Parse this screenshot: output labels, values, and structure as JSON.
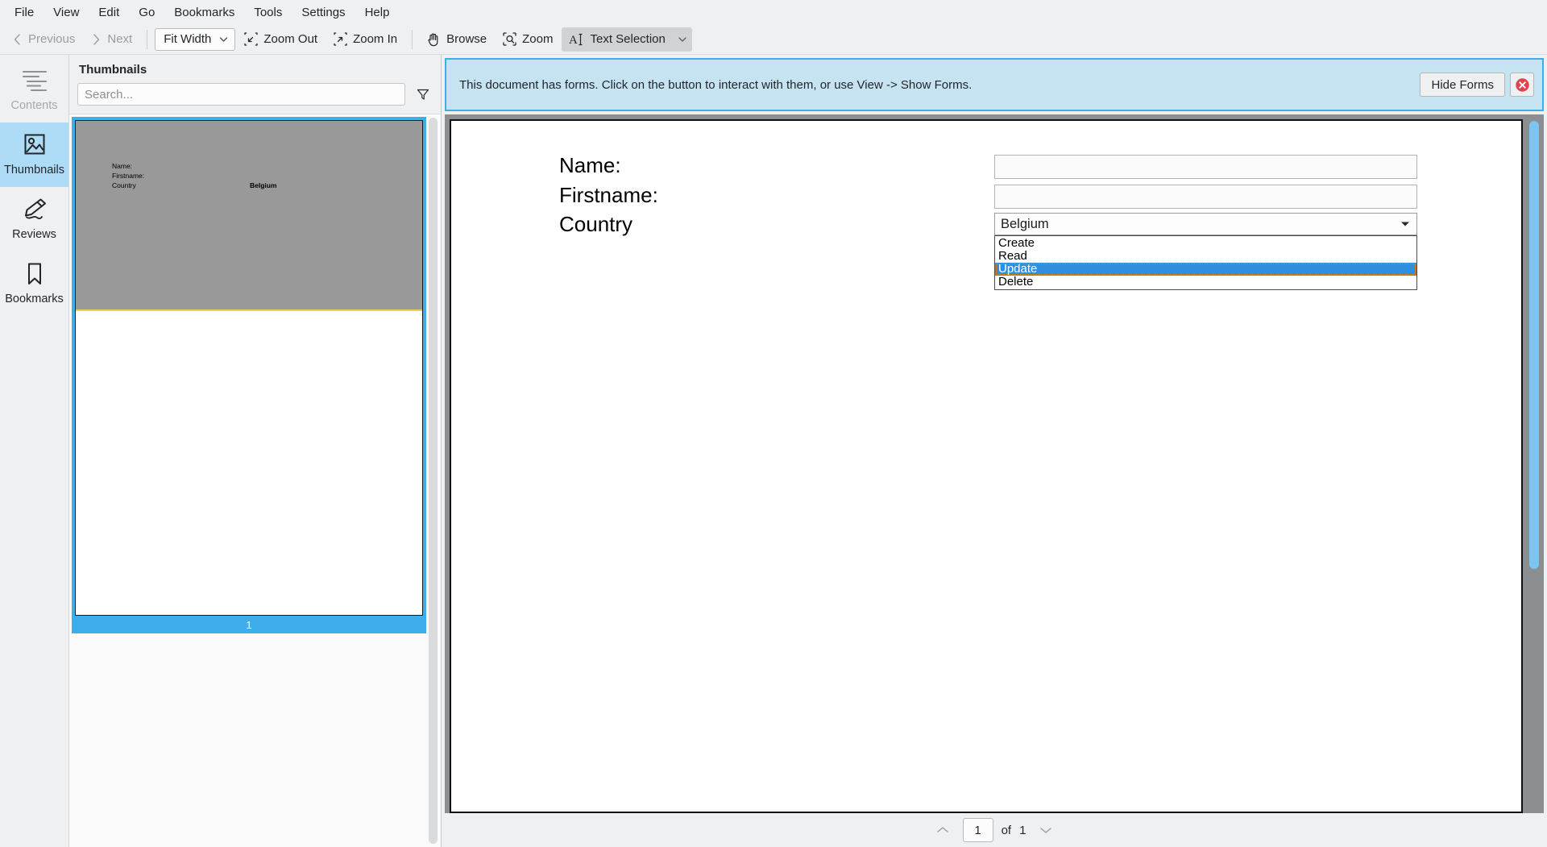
{
  "menubar": {
    "items": [
      {
        "label": "File"
      },
      {
        "label": "View"
      },
      {
        "label": "Edit"
      },
      {
        "label": "Go"
      },
      {
        "label": "Bookmarks"
      },
      {
        "label": "Tools"
      },
      {
        "label": "Settings"
      },
      {
        "label": "Help"
      }
    ]
  },
  "toolbar": {
    "previous_label": "Previous",
    "next_label": "Next",
    "zoom_mode": "Fit Width",
    "zoom_out_label": "Zoom Out",
    "zoom_in_label": "Zoom In",
    "browse_label": "Browse",
    "zoom_label": "Zoom",
    "text_selection_label": "Text Selection"
  },
  "sidebar": {
    "items": [
      {
        "label": "Contents",
        "icon": "contents-icon",
        "state": "disabled"
      },
      {
        "label": "Thumbnails",
        "icon": "thumbnails-icon",
        "state": "selected"
      },
      {
        "label": "Reviews",
        "icon": "reviews-icon",
        "state": "normal"
      },
      {
        "label": "Bookmarks",
        "icon": "bookmarks-icon",
        "state": "normal"
      }
    ]
  },
  "thumbnails_panel": {
    "title": "Thumbnails",
    "search_placeholder": "Search...",
    "search_value": "",
    "filter_icon": "filter-funnel-icon",
    "page": {
      "number": "1",
      "preview_lines": [
        "Name:",
        "Firstname:",
        "Country"
      ],
      "preview_value": "Belgium"
    }
  },
  "forms_notification": {
    "message": "This document has forms. Click on the button to interact with them, or use View -> Show Forms.",
    "hide_button_label": "Hide Forms",
    "close_icon": "close-circle-icon",
    "accent_color": "#3daee9",
    "background_color": "#c6e3f2"
  },
  "document": {
    "fields": [
      {
        "label": "Name:",
        "type": "text",
        "value": ""
      },
      {
        "label": "Firstname:",
        "type": "text",
        "value": ""
      },
      {
        "label": "Country",
        "type": "select",
        "value": "Belgium"
      }
    ],
    "dropdown": {
      "open": true,
      "selected": "Update",
      "options": [
        "Create",
        "Read",
        "Update",
        "Delete"
      ],
      "highlight_color": "#2f8fdf"
    }
  },
  "statusbar": {
    "prev_icon": "chevron-up-icon",
    "next_icon": "chevron-down-icon",
    "current_page": "1",
    "of_label": "of",
    "total_pages": "1"
  }
}
